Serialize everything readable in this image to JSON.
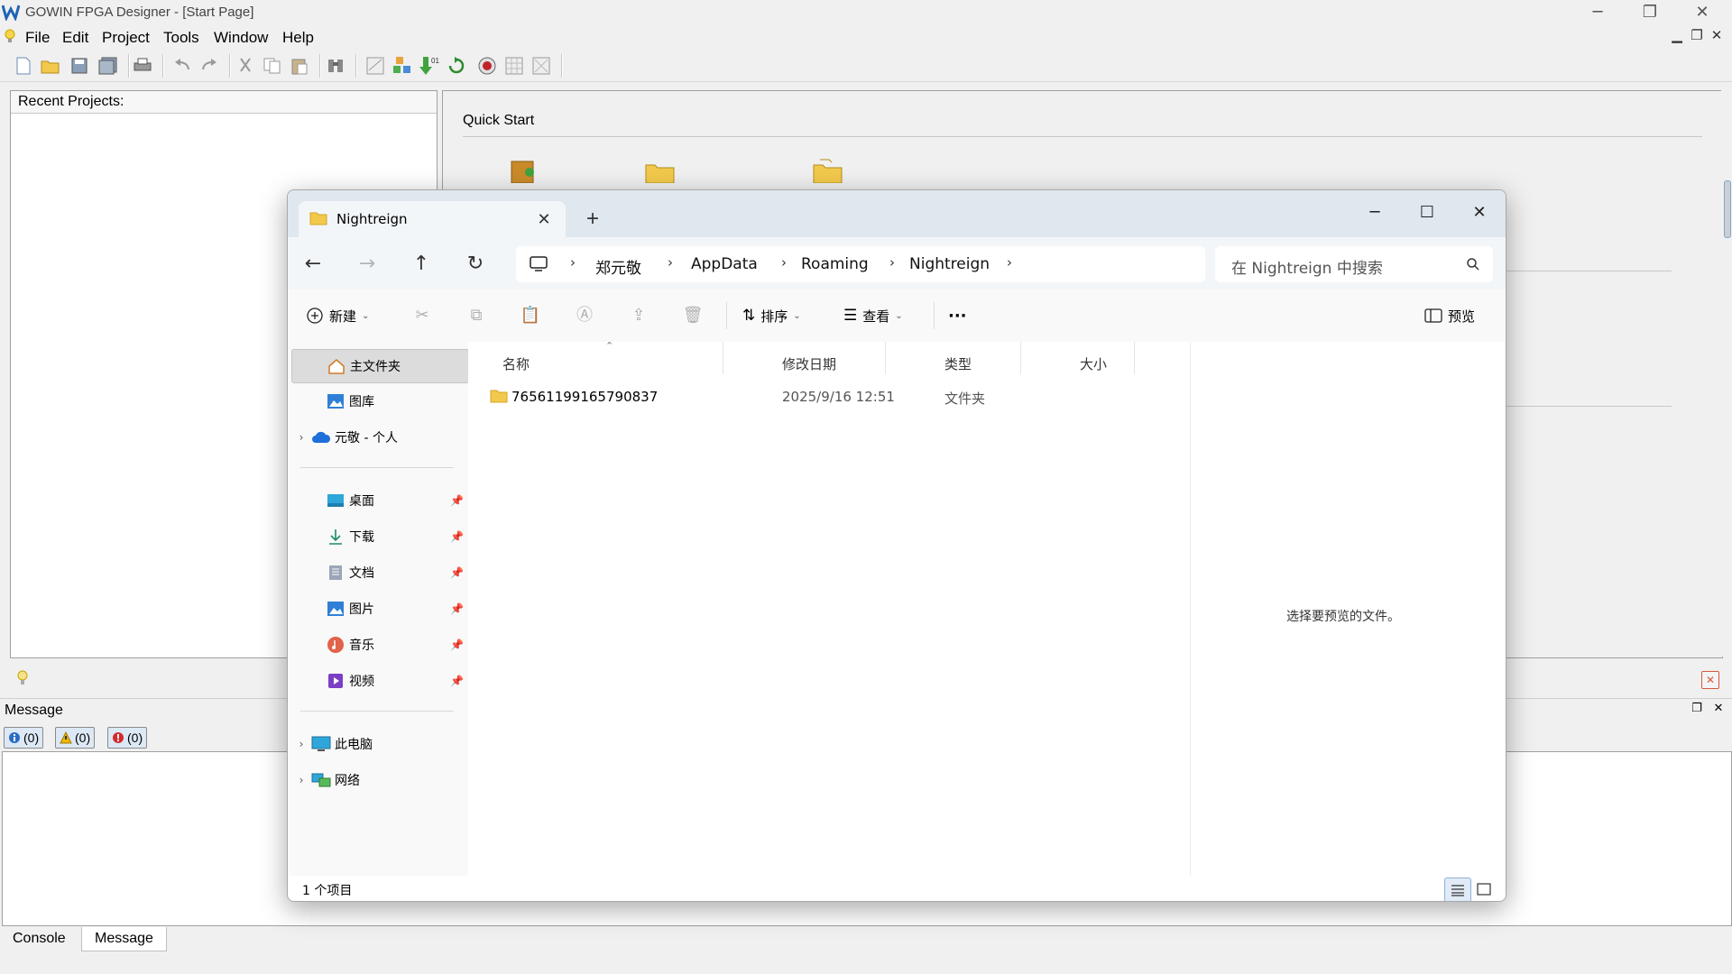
{
  "gowin": {
    "title": "GOWIN FPGA Designer - [Start Page]",
    "menu": [
      "File",
      "Edit",
      "Project",
      "Tools",
      "Window",
      "Help"
    ],
    "recent_projects_label": "Recent Projects:",
    "quick_start_label": "Quick Start",
    "message_label": "Message",
    "filters": {
      "info": "(0)",
      "warning": "(0)",
      "error": "(0)"
    },
    "bottom_tabs": [
      "Console",
      "Message"
    ]
  },
  "explorer": {
    "tab_title": "Nightreign",
    "tab_close": "✕",
    "new_tab": "+",
    "breadcrumbs": [
      "郑元敬",
      "AppData",
      "Roaming",
      "Nightreign"
    ],
    "search_placeholder": "在 Nightreign 中搜索",
    "commands": {
      "new": "新建",
      "sort": "排序",
      "view": "查看",
      "more": "···",
      "preview": "预览"
    },
    "nav": {
      "home": "主文件夹",
      "gallery": "图库",
      "onedrive": "元敬 - 个人",
      "desktop": "桌面",
      "downloads": "下载",
      "documents": "文档",
      "pictures": "图片",
      "music": "音乐",
      "videos": "视频",
      "this_pc": "此电脑",
      "network": "网络"
    },
    "columns": {
      "name": "名称",
      "modified": "修改日期",
      "type": "类型",
      "size": "大小"
    },
    "rows": [
      {
        "name": "76561199165790837",
        "modified": "2025/9/16 12:51",
        "type": "文件夹",
        "size": ""
      }
    ],
    "preview_text": "选择要预览的文件。",
    "status_count": "1 个项目",
    "colors": {
      "titlebar": "#dfe7ef",
      "folder": "#f2c94c",
      "onedrive": "#1e6fd9"
    }
  }
}
